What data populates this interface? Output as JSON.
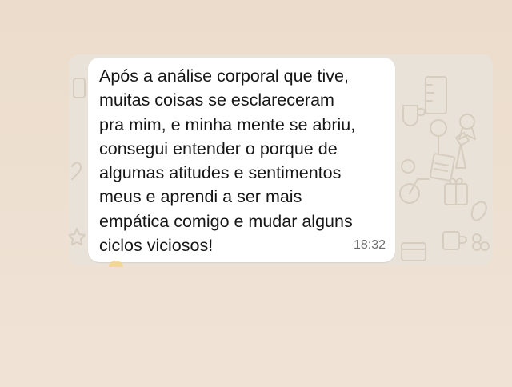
{
  "message": {
    "text": "Após a análise corporal que tive,\nmuitas coisas se esclareceram\npra mim, e minha mente se abriu,\nconsegui entender o porque de\nalgumas atitudes e sentimentos\nmeus e aprendi a ser mais\nempática comigo e mudar alguns\nciclos viciosos!",
    "time": "18:32"
  },
  "icons": {
    "wallpaper": "doodle-pattern-icons",
    "reaction": "emoji-reaction-icon"
  },
  "colors": {
    "page_background": "#ecdccb",
    "chat_background": "#e9e2d8",
    "bubble": "#ffffff",
    "text": "#161616",
    "timestamp": "#6f6f6f"
  }
}
